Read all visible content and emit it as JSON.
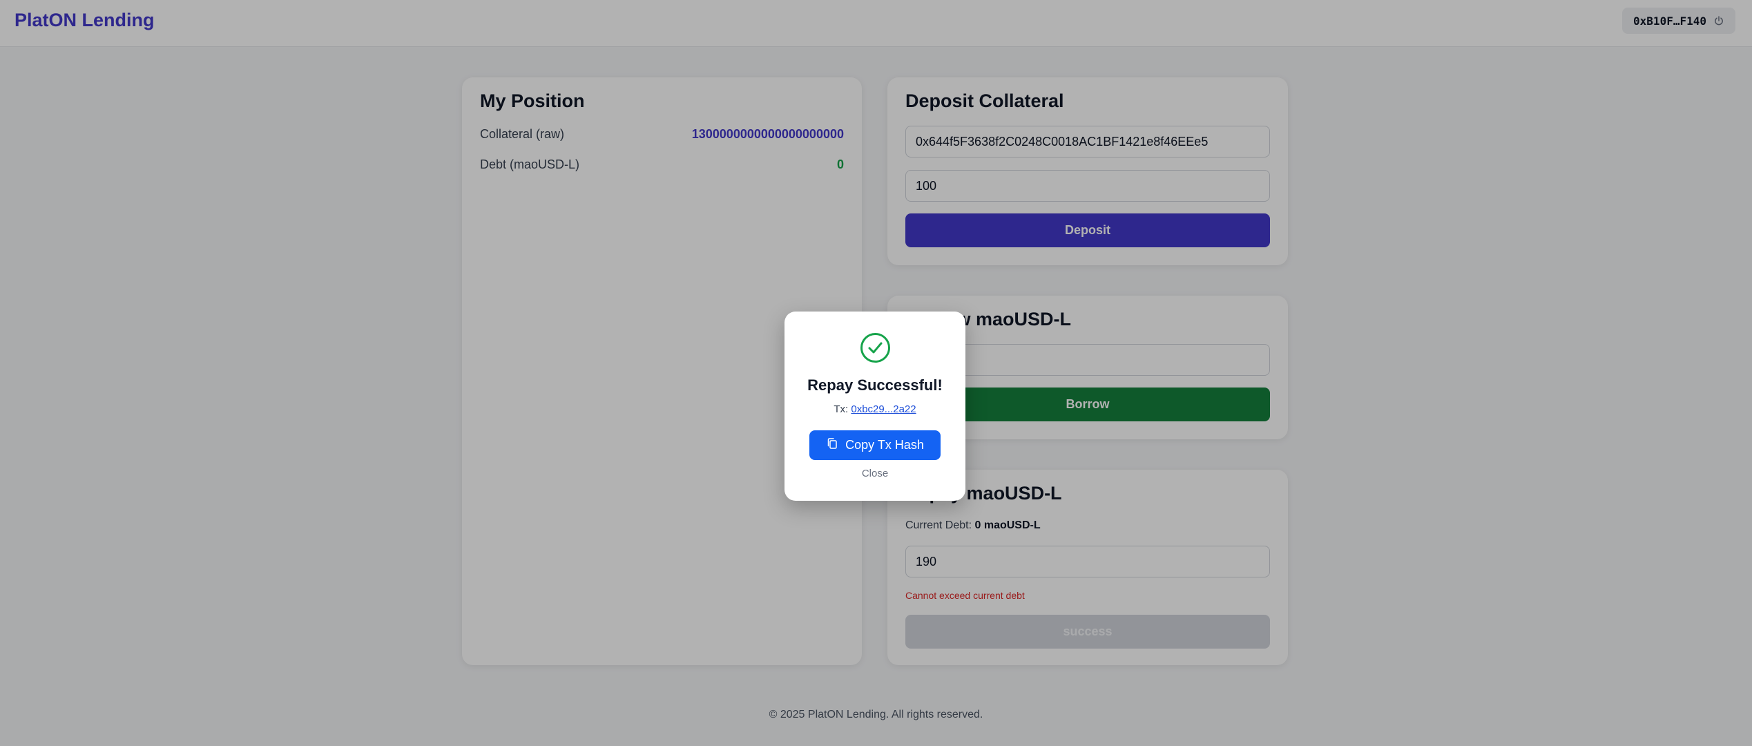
{
  "header": {
    "brand": "PlatON Lending",
    "wallet_address": "0xB10F…F140",
    "wallet_icon": "power-icon"
  },
  "position": {
    "title": "My Position",
    "collateral_label": "Collateral (raw)",
    "collateral_value": "1300000000000000000000",
    "debt_label": "Debt (maoUSD-L)",
    "debt_value": "0"
  },
  "deposit": {
    "title": "Deposit Collateral",
    "address_value": "0x644f5F3638f2C0248C0018AC1BF1421e8f46EEe5",
    "amount_value": "100",
    "button_label": "Deposit"
  },
  "borrow": {
    "title": "Borrow maoUSD-L",
    "amount_value": "",
    "button_label": "Borrow"
  },
  "repay": {
    "title": "Repay maoUSD-L",
    "current_debt_label": "Current Debt:",
    "current_debt_value": "0 maoUSD-L",
    "amount_value": "190",
    "error_text": "Cannot exceed current debt",
    "button_label": "success"
  },
  "modal": {
    "icon": "check-circle-icon",
    "title": "Repay Successful!",
    "tx_label": "Tx:",
    "tx_hash": "0xbc29...2a22",
    "copy_label": "Copy Tx Hash",
    "copy_icon": "copy-icon",
    "close_label": "Close"
  },
  "footer": {
    "text": "© 2025 PlatON Lending. All rights reserved."
  },
  "colors": {
    "brand": "#4338ca",
    "deposit_button": "#4338ca",
    "borrow_button": "#15803d",
    "repay_button_disabled": "#d1d5db",
    "success": "#16a34a",
    "error": "#dc2626",
    "copy_button": "#1463f3"
  }
}
